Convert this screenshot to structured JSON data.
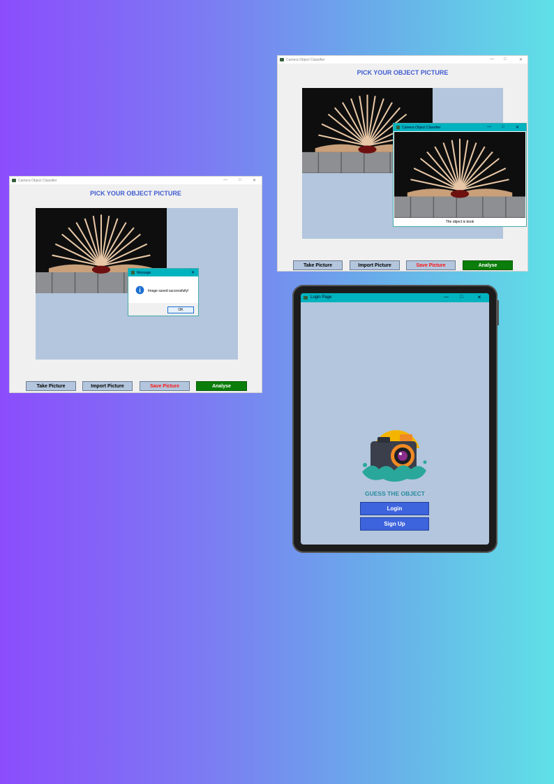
{
  "window_left": {
    "title": "Camera Object Classifier",
    "heading": "PICK YOUR OBJECT PICTURE",
    "dialog": {
      "title": "Message",
      "message": "Image saved successfully!",
      "ok_label": "OK"
    },
    "buttons": {
      "take": "Take Picture",
      "import": "Import Picture",
      "save": "Save Picture",
      "analyse": "Analyse"
    }
  },
  "window_right": {
    "title": "Camera Object Classifier",
    "heading": "PICK YOUR OBJECT PICTURE",
    "result_window": {
      "title": "Camera Object Classifier",
      "result_text": "The object is book"
    },
    "buttons": {
      "take": "Take Picture",
      "import": "Import Picture",
      "save": "Save Picture",
      "analyse": "Analyse"
    }
  },
  "login_window": {
    "title": "Login Page",
    "app_name": "GUESS THE OBJECT",
    "login_label": "Login",
    "signup_label": "Sign Up"
  },
  "colors": {
    "accent_blue": "#3d63dd",
    "title_bar": "#00b3bf",
    "panel": "#b3c6dd",
    "analyse": "#0a7d0a",
    "save_text": "#ff1010"
  },
  "window_controls": {
    "minimize": "—",
    "maximize": "□",
    "close": "✕"
  }
}
